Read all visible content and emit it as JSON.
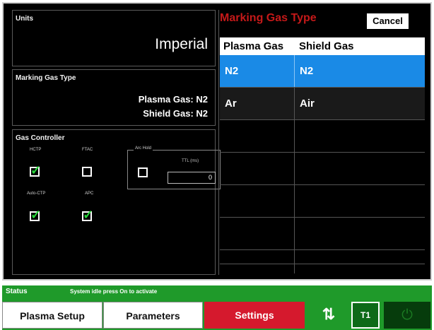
{
  "units": {
    "title": "Units",
    "value": "Imperial"
  },
  "marking_gas": {
    "title": "Marking Gas Type",
    "plasma": "Plasma Gas: N2",
    "shield": "Shield Gas: N2"
  },
  "gas_controller": {
    "title": "Gas Controller",
    "checkboxes": [
      {
        "label": "HCTP",
        "checked": true
      },
      {
        "label": "FTAC",
        "checked": false
      },
      {
        "label": "Auto-CTP",
        "checked": true
      },
      {
        "label": "APC",
        "checked": true
      }
    ],
    "arc_hold": {
      "title": "Arc Hold",
      "checked": false,
      "ttl_label": "TTL (ms)",
      "ttl_value": "0"
    }
  },
  "right_panel": {
    "title": "Marking Gas Type",
    "cancel": "Cancel",
    "columns": [
      "Plasma Gas",
      "Shield Gas"
    ],
    "rows": [
      {
        "plasma": "N2",
        "shield": "N2",
        "selected": true
      },
      {
        "plasma": "Ar",
        "shield": "Air",
        "selected": false
      }
    ]
  },
  "status": {
    "label": "Status",
    "message": "System idle press On to activate"
  },
  "bottom_bar": {
    "tabs": [
      "Plasma Setup",
      "Parameters",
      "Settings"
    ],
    "active_tab": "Settings",
    "t1_label": "T1"
  },
  "colors": {
    "accent_green": "#1f9a2a",
    "active_red": "#d5192d",
    "selection_blue": "#1a8ae6",
    "title_red": "#c51919"
  }
}
